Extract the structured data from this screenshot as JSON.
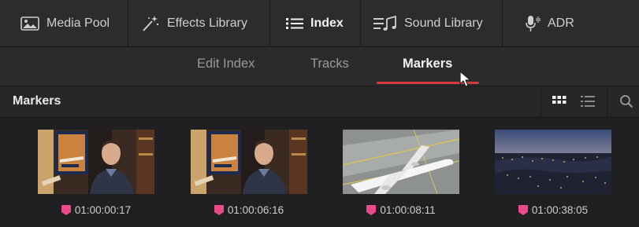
{
  "toolbar": {
    "items": [
      {
        "label": "Media Pool",
        "icon": "media-pool-icon"
      },
      {
        "label": "Effects Library",
        "icon": "magic-wand-icon"
      },
      {
        "label": "Index",
        "icon": "list-icon",
        "active": true
      },
      {
        "label": "Sound Library",
        "icon": "music-note-icon"
      },
      {
        "label": "ADR",
        "icon": "microphone-icon"
      }
    ]
  },
  "subtabs": {
    "items": [
      {
        "label": "Edit Index"
      },
      {
        "label": "Tracks"
      },
      {
        "label": "Markers",
        "active": true
      }
    ]
  },
  "panel": {
    "title": "Markers",
    "view_modes": [
      "grid-view-icon",
      "list-view-icon"
    ],
    "search_icon": "search-icon"
  },
  "clips": [
    {
      "timecode": "01:00:00:17",
      "thumbnail": "man-in-room-thumbnail"
    },
    {
      "timecode": "01:00:06:16",
      "thumbnail": "man-in-room-thumbnail"
    },
    {
      "timecode": "01:00:08:11",
      "thumbnail": "airplane-on-runway-thumbnail"
    },
    {
      "timecode": "01:00:38:05",
      "thumbnail": "city-at-night-thumbnail"
    }
  ],
  "colors": {
    "accent": "#d43a3e",
    "marker": "#e94a8a",
    "background": "#262628"
  }
}
